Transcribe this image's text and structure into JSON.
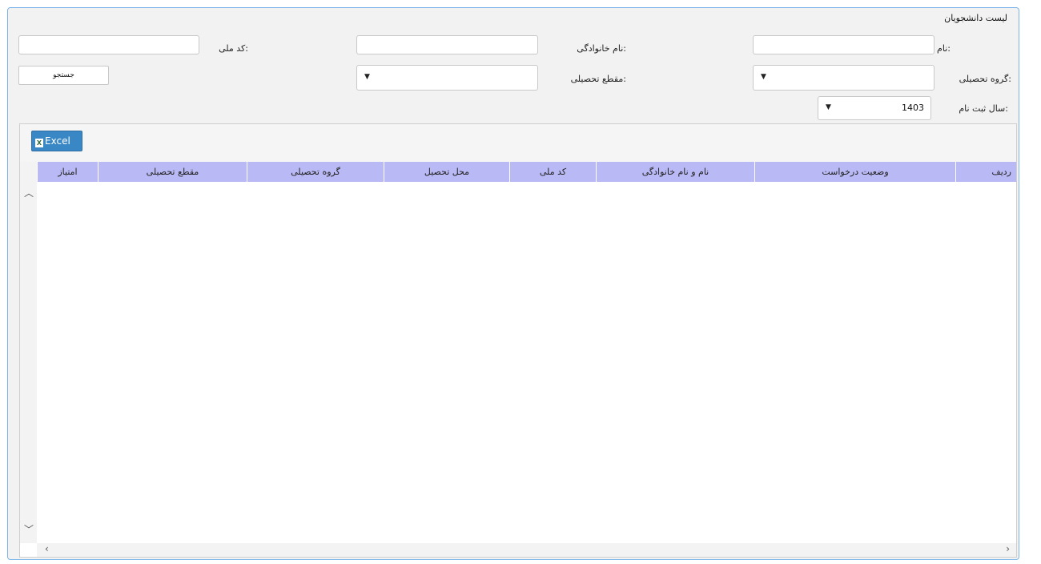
{
  "panel": {
    "title": "لیست دانشجویان"
  },
  "filters": {
    "name_label": "نام:",
    "family_label": "نام خانوادگی:",
    "national_code_label": "کد ملی:",
    "field_group_label": "گروه تحصیلی:",
    "degree_label": "مقطع تحصیلی:",
    "reg_year_label": "سال ثبت نام:",
    "reg_year_value": "1403",
    "search_button": "جستجو"
  },
  "grid": {
    "excel_label": "Excel",
    "columns": [
      "ردیف",
      "وضعیت درخواست",
      "نام و نام خانوادگی",
      "کد ملی",
      "محل تحصیل",
      "گروه تحصیلی",
      "مقطع تحصیلی",
      "امتیاز"
    ]
  },
  "icons": {
    "dropdown": "triangle-down-icon",
    "excel": "excel-icon",
    "scroll_up": "chevron-up-icon",
    "scroll_down": "chevron-down-icon",
    "scroll_left": "chevron-left-icon",
    "scroll_right": "chevron-right-icon"
  },
  "colors": {
    "panel_border": "#7ab4e8",
    "header_bg": "#b9b9f5",
    "excel_bg": "#3a87c6"
  }
}
